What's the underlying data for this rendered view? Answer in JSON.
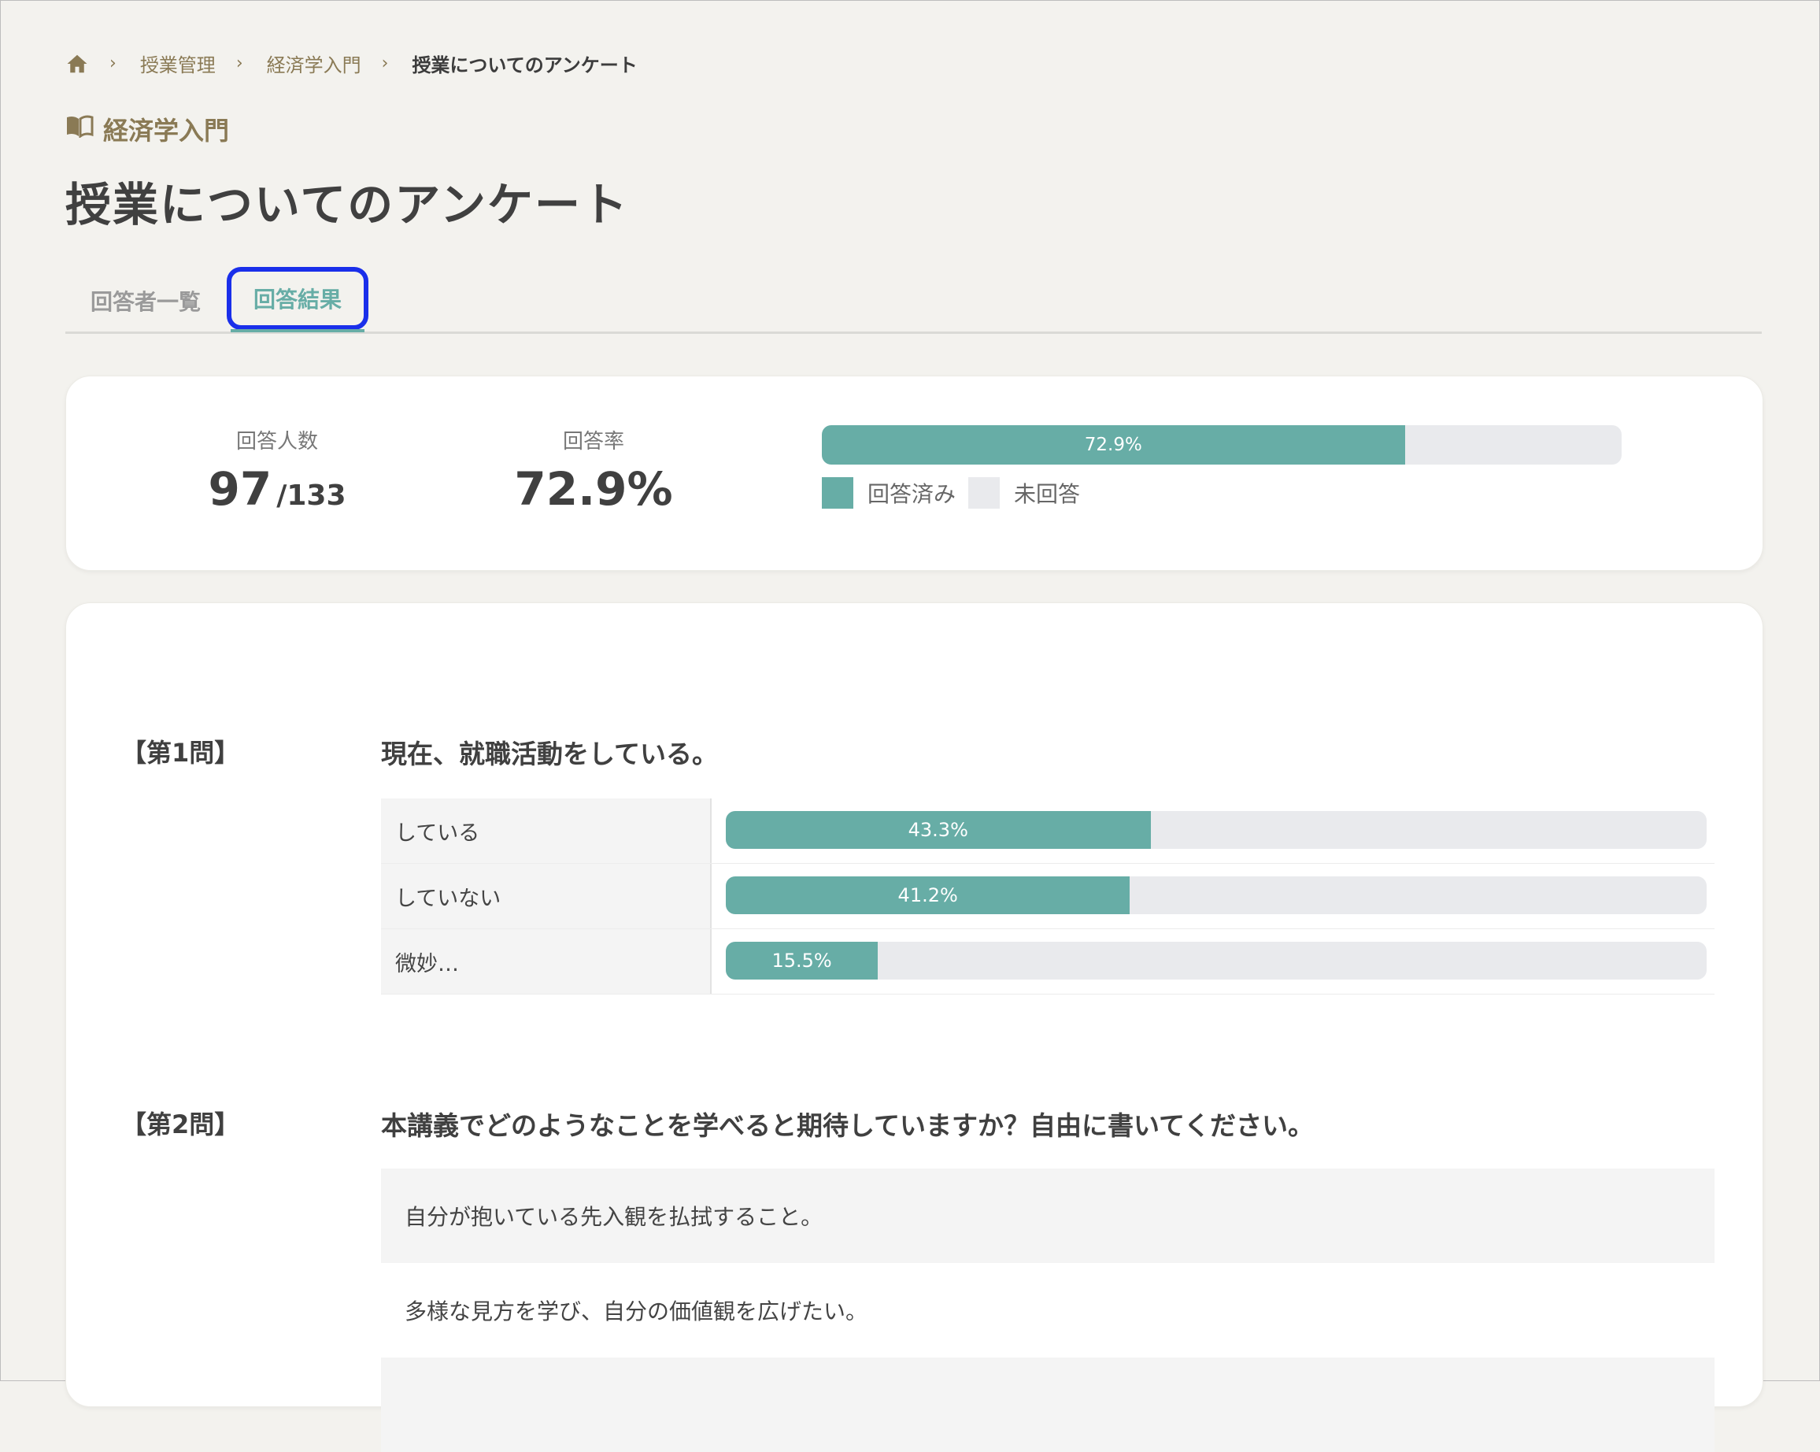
{
  "breadcrumb": {
    "home_icon": "home-icon",
    "items": [
      "授業管理",
      "経済学入門"
    ],
    "current": "授業についてのアンケート"
  },
  "course": {
    "icon": "book-icon",
    "title": "経済学入門"
  },
  "page_title": "授業についてのアンケート",
  "tabs": [
    {
      "label": "回答者一覧",
      "active": false
    },
    {
      "label": "回答結果",
      "active": true
    }
  ],
  "summary": {
    "respondents_label": "回答人数",
    "respondents_count": "97",
    "respondents_total": "/133",
    "rate_label": "回答率",
    "rate_value": "72.9%",
    "rate_bar_label": "72.9%",
    "rate_fraction": 0.729,
    "legend_done": "回答済み",
    "legend_not": "未回答",
    "color_done": "#67ada6",
    "color_not": "#e9eaed"
  },
  "questions": [
    {
      "number": "【第1問】",
      "text": "現在、就職活動をしている。",
      "options": [
        {
          "label": "している",
          "percent_label": "43.3%",
          "fraction": 0.433
        },
        {
          "label": "していない",
          "percent_label": "41.2%",
          "fraction": 0.412
        },
        {
          "label": "微妙…",
          "percent_label": "15.5%",
          "fraction": 0.155
        }
      ]
    },
    {
      "number": "【第2問】",
      "text": "本講義でどのようなことを学べると期待していますか？自由に書いてください。",
      "answers": [
        "自分が抱いている先入観を払拭すること。",
        "多様な見方を学び、自分の価値観を広げたい。",
        ""
      ]
    }
  ]
}
